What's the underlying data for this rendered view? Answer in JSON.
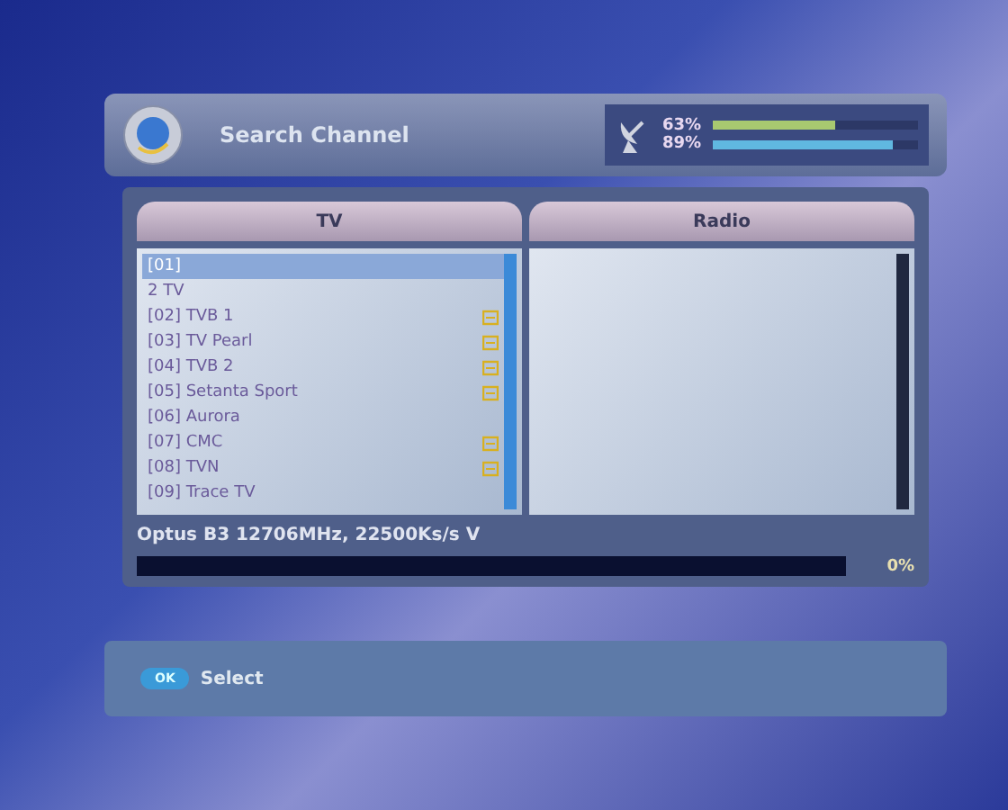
{
  "header": {
    "title": "Search Channel",
    "signal": {
      "reading": "63%",
      "level": 0.6
    },
    "quality": {
      "reading": "89%",
      "level": 0.88
    }
  },
  "tv": {
    "title": "TV",
    "channels": [
      {
        "name": "[01]",
        "scrambled": false,
        "selected": true
      },
      {
        "name": "2 TV",
        "scrambled": false,
        "selected": false
      },
      {
        "name": "[02] TVB 1",
        "scrambled": true,
        "selected": false
      },
      {
        "name": "[03] TV Pearl",
        "scrambled": true,
        "selected": false
      },
      {
        "name": "[04] TVB 2",
        "scrambled": true,
        "selected": false
      },
      {
        "name": "[05] Setanta Sport",
        "scrambled": true,
        "selected": false
      },
      {
        "name": "[06] Aurora",
        "scrambled": false,
        "selected": false
      },
      {
        "name": "[07] CMC",
        "scrambled": true,
        "selected": false
      },
      {
        "name": "[08] TVN",
        "scrambled": true,
        "selected": false
      },
      {
        "name": "[09] Trace TV",
        "scrambled": false,
        "selected": false
      }
    ]
  },
  "radio": {
    "title": "Radio"
  },
  "transponder": {
    "text": "Optus B3 12706MHz, 22500Ks/s V",
    "progress": {
      "level": 0,
      "reading": "0%"
    }
  },
  "footer": {
    "key": "OK",
    "label": "Select"
  }
}
